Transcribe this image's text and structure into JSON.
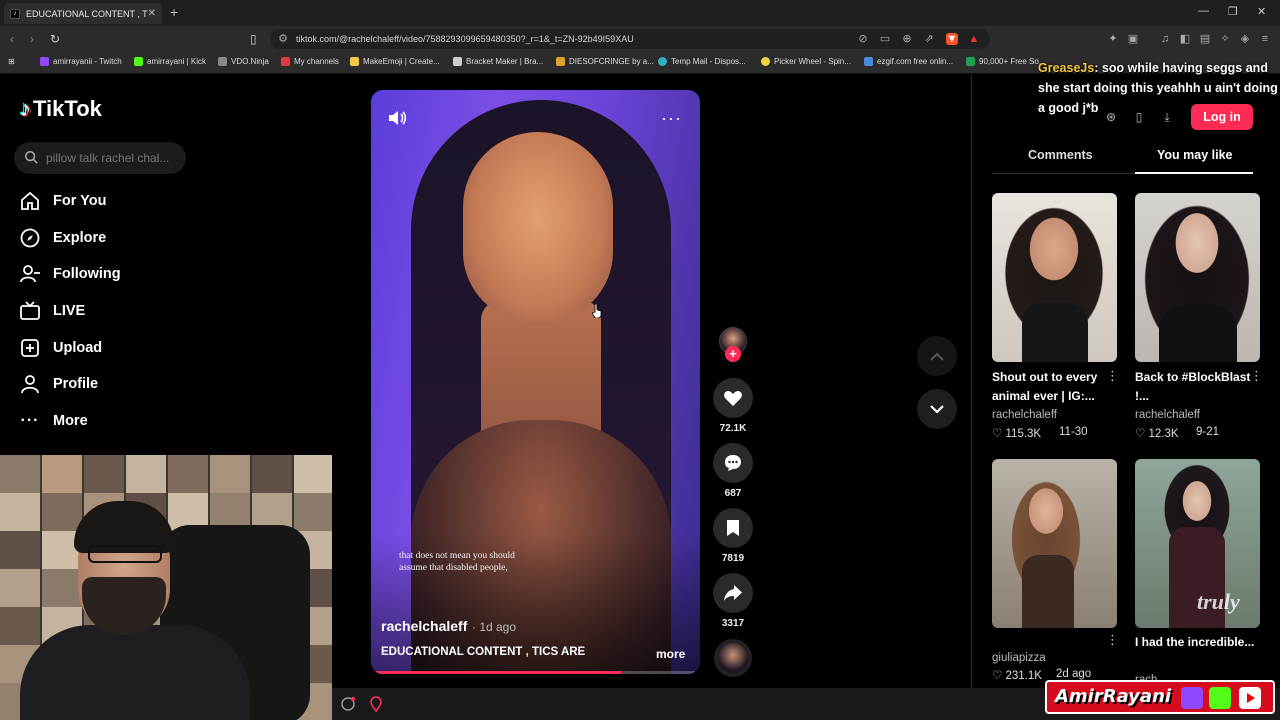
{
  "browser": {
    "tab_title": "EDUCATIONAL CONTENT , TICS",
    "tab_close": "✕",
    "new_tab": "+",
    "url": "tiktok.com/@rachelchaleff/video/7588293099659480350?_r=1&_t=ZN-92b49I59XAU",
    "window_controls": [
      "—",
      "❐",
      "✕"
    ],
    "bookmarks": [
      {
        "label": "amirrayanii - Twitch",
        "color": "#9146ff"
      },
      {
        "label": "amirrayani | Kick",
        "color": "#53fc18"
      },
      {
        "label": "VDO.Ninja",
        "color": "#888888"
      },
      {
        "label": "My channels",
        "color": "#e03a3a"
      },
      {
        "label": "MakeEmoji | Create...",
        "color": "#f2c94c"
      },
      {
        "label": "Bracket Maker | Bra...",
        "color": "#cccccc"
      },
      {
        "label": "DIESOFCRINGE by a...",
        "color": "#e0a030"
      },
      {
        "label": "Temp Mail - Dispos...",
        "color": "#30b0c0"
      },
      {
        "label": "Picker Wheel - Spin...",
        "color": "#f2d53c"
      },
      {
        "label": "ezgif.com free onlin...",
        "color": "#4a8ad8"
      },
      {
        "label": "90,000+ Free So...",
        "color": "#20a050"
      }
    ]
  },
  "sidebar": {
    "logo": "TikTok",
    "search_placeholder": "pillow talk rachel chal...",
    "items": [
      {
        "label": "For You",
        "icon": "home-icon"
      },
      {
        "label": "Explore",
        "icon": "compass-icon"
      },
      {
        "label": "Following",
        "icon": "following-icon"
      },
      {
        "label": "LIVE",
        "icon": "live-icon"
      },
      {
        "label": "Upload",
        "icon": "upload-icon"
      },
      {
        "label": "Profile",
        "icon": "profile-icon"
      },
      {
        "label": "More",
        "icon": "more-icon"
      }
    ]
  },
  "video": {
    "caption_line1": "that does not mean you should",
    "caption_line2": "assume that disabled people,",
    "author": "rachelchaleff",
    "age": "· 1d ago",
    "description": "EDUCATIONAL CONTENT , TICS ARE",
    "more": "more",
    "progress": 0.76
  },
  "actions": {
    "plus": "+",
    "likes": "72.1K",
    "comments": "687",
    "saves": "7819",
    "shares": "3317"
  },
  "right_panel": {
    "chat_username": "GreaseJs",
    "chat_message": ": soo while having seggs and she start doing this yeahhh u ain't doing a good j*b",
    "login": "Log in",
    "tabs": [
      "Comments",
      "You may like"
    ],
    "cards": [
      {
        "title": "Shout out to every animal ever | IG:...",
        "author": "rachelchaleff",
        "likes": "♡ 115.3K",
        "date": "11-30"
      },
      {
        "title": "Back to #BlockBlast !...",
        "author": "rachelchaleff",
        "likes": "♡ 12.3K",
        "date": "9-21"
      },
      {
        "title": "",
        "author": "giuliapizza",
        "likes": "♡ 231.1K",
        "date": "2d ago"
      },
      {
        "title": "I had the incredible...",
        "author": "rach",
        "likes": "",
        "date": "",
        "watermark": "truly"
      }
    ]
  },
  "overlay_brand": {
    "name": "AmirRayani"
  },
  "colors": {
    "accent": "#fe2c55",
    "background": "#000000",
    "panel": "#1c1c1c"
  }
}
